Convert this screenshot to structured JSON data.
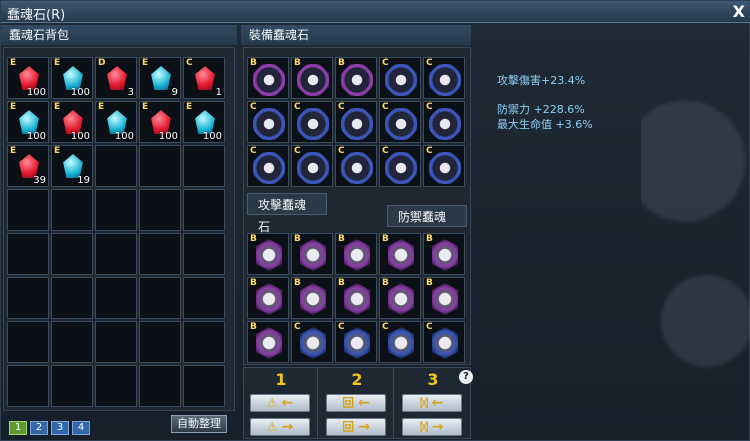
{
  "window": {
    "title": "蠢魂石(R)",
    "close_label": "X"
  },
  "inventory": {
    "header": "蠢魂石背包",
    "items": [
      {
        "grade": "E",
        "color": "red",
        "qty": "100"
      },
      {
        "grade": "E",
        "color": "blue",
        "qty": "100"
      },
      {
        "grade": "D",
        "color": "red",
        "qty": "3"
      },
      {
        "grade": "E",
        "color": "blue",
        "qty": "9"
      },
      {
        "grade": "C",
        "color": "red",
        "qty": "1"
      },
      {
        "grade": "E",
        "color": "blue",
        "qty": "100"
      },
      {
        "grade": "E",
        "color": "red",
        "qty": "100"
      },
      {
        "grade": "E",
        "color": "blue",
        "qty": "100"
      },
      {
        "grade": "E",
        "color": "red",
        "qty": "100"
      },
      {
        "grade": "E",
        "color": "blue",
        "qty": "100"
      },
      {
        "grade": "E",
        "color": "red",
        "qty": "39"
      },
      {
        "grade": "E",
        "color": "blue",
        "qty": "19"
      }
    ],
    "total_slots": 40
  },
  "equipped": {
    "header": "裝備蠢魂石",
    "attack_tab": "攻擊蠢魂石",
    "defense_tab": "防禦蠢魂石",
    "attack_slots": [
      {
        "grade": "B",
        "tone": "purple"
      },
      {
        "grade": "B",
        "tone": "purple"
      },
      {
        "grade": "B",
        "tone": "purple"
      },
      {
        "grade": "C",
        "tone": "navy"
      },
      {
        "grade": "C",
        "tone": "navy"
      },
      {
        "grade": "C",
        "tone": "navy"
      },
      {
        "grade": "C",
        "tone": "navy"
      },
      {
        "grade": "C",
        "tone": "navy"
      },
      {
        "grade": "C",
        "tone": "navy"
      },
      {
        "grade": "C",
        "tone": "navy"
      },
      {
        "grade": "C",
        "tone": "navy"
      },
      {
        "grade": "C",
        "tone": "navy"
      },
      {
        "grade": "C",
        "tone": "navy"
      },
      {
        "grade": "C",
        "tone": "navy"
      },
      {
        "grade": "C",
        "tone": "navy"
      }
    ],
    "defense_slots": [
      {
        "grade": "B",
        "tone": "purple"
      },
      {
        "grade": "B",
        "tone": "purple"
      },
      {
        "grade": "B",
        "tone": "purple"
      },
      {
        "grade": "B",
        "tone": "purple"
      },
      {
        "grade": "B",
        "tone": "purple"
      },
      {
        "grade": "B",
        "tone": "purple"
      },
      {
        "grade": "B",
        "tone": "purple"
      },
      {
        "grade": "B",
        "tone": "purple"
      },
      {
        "grade": "B",
        "tone": "purple"
      },
      {
        "grade": "B",
        "tone": "purple"
      },
      {
        "grade": "B",
        "tone": "purple"
      },
      {
        "grade": "C",
        "tone": "navy"
      },
      {
        "grade": "C",
        "tone": "navy"
      },
      {
        "grade": "C",
        "tone": "navy"
      },
      {
        "grade": "C",
        "tone": "navy"
      }
    ]
  },
  "stats": {
    "attack": "攻擊傷害+23.4%",
    "defense": "防禦力 +228.6%",
    "hp": "最大生命值 +3.6%"
  },
  "presets": [
    {
      "number": "1",
      "symbol": "⚠"
    },
    {
      "number": "2",
      "symbol": "回"
    },
    {
      "number": "3",
      "symbol": "ᛞ"
    }
  ],
  "arrows": {
    "left": "←",
    "right": "→"
  },
  "help_label": "?",
  "pages": [
    "1",
    "2",
    "3",
    "4"
  ],
  "sort_button": "自動整理"
}
